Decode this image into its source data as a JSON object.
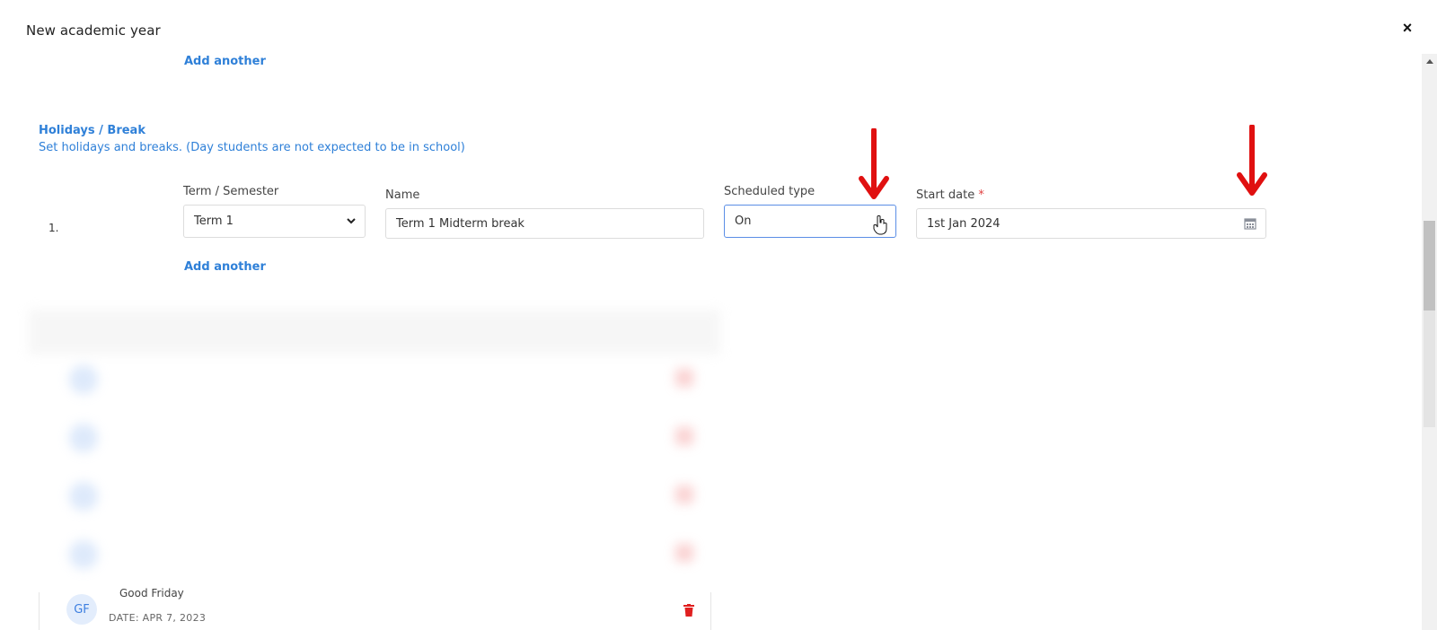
{
  "modal": {
    "title": "New academic year",
    "close_label": "×"
  },
  "top": {
    "add_another_label": "Add another"
  },
  "holidays": {
    "title": "Holidays / Break",
    "description": "Set holidays and breaks. (Day students are not expected to be in school)",
    "rows": [
      {
        "number": "1.",
        "term_label": "Term / Semester",
        "term_value": "Term 1",
        "name_label": "Name",
        "name_value": "Term 1 Midterm break",
        "scheduled_label": "Scheduled type",
        "scheduled_value": "On",
        "start_label": "Start date",
        "start_required": "*",
        "start_value": "1st Jan 2024"
      }
    ],
    "add_another_label": "Add another"
  },
  "list": {
    "bottom_item": {
      "initials": "GF",
      "name": "Good Friday",
      "date": "DATE: APR 7, 2023"
    }
  },
  "colors": {
    "accent": "#2f80d8",
    "annotation_arrow": "#e01010",
    "trash": "#e02020"
  },
  "icons": {
    "close": "close-icon",
    "chevron": "chevron-down-icon",
    "calendar": "calendar-icon",
    "trash": "trash-icon",
    "cursor": "pointer-cursor-icon"
  }
}
